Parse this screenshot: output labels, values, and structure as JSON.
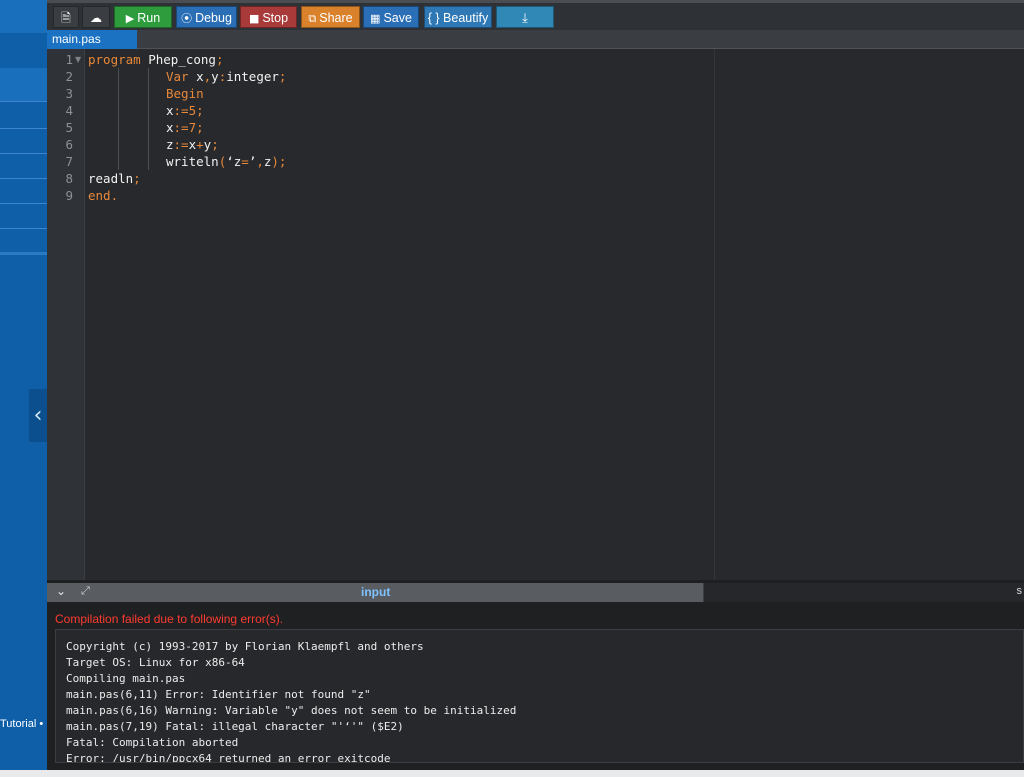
{
  "toolbar": {
    "buttons": [
      {
        "label": "",
        "icon": "new-file-icon",
        "color": "#3a3d42"
      },
      {
        "label": "",
        "icon": "upload-icon",
        "color": "#3a3d42"
      },
      {
        "label": "Run",
        "icon": "play-icon",
        "color": "#2e9c3d"
      },
      {
        "label": "Debug",
        "icon": "debug-icon",
        "color": "#2a6eb5"
      },
      {
        "label": "Stop",
        "icon": "stop-icon",
        "color": "#a83a3a"
      },
      {
        "label": "Share",
        "icon": "share-icon",
        "color": "#d9822b"
      },
      {
        "label": "Save",
        "icon": "save-icon",
        "color": "#2a6eb5"
      },
      {
        "label": "{ } Beautify",
        "icon": "",
        "color": "#2f78b6"
      },
      {
        "label": "",
        "icon": "download-icon",
        "color": "#2f88b6"
      }
    ]
  },
  "file_tab": "main.pas",
  "editor": {
    "lines": [
      {
        "num": "1",
        "text": "program Phep_cong;"
      },
      {
        "num": "2",
        "text": "Var x,y:integer;"
      },
      {
        "num": "3",
        "text": "Begin"
      },
      {
        "num": "4",
        "text": "x:=5;"
      },
      {
        "num": "5",
        "text": "x:=7;"
      },
      {
        "num": "6",
        "text": "z:=x+y;"
      },
      {
        "num": "7",
        "text": "writeln('z=',z);"
      },
      {
        "num": "8",
        "text": "readln;"
      },
      {
        "num": "9",
        "text": "end."
      }
    ]
  },
  "panel": {
    "input_label": "input",
    "right_label": "s"
  },
  "output": {
    "error_message": "Compilation failed due to following error(s).",
    "console_lines": [
      "Copyright (c) 1993-2017 by Florian Klaempfl and others",
      "Target OS: Linux for x86-64",
      "Compiling main.pas",
      "main.pas(6,11) Error: Identifier not found \"z\"",
      "main.pas(6,16) Warning: Variable \"y\" does not seem to be initialized",
      "main.pas(7,19) Fatal: illegal character \"'‘'\" ($E2)",
      "Fatal: Compilation aborted",
      "Error: /usr/bin/ppcx64 returned an error exitcode"
    ]
  },
  "sidebar": {
    "tutorial_label": "Tutorial •"
  },
  "colors": {
    "keyword": "#e8883a",
    "accent": "#1b72c2",
    "error": "#ff3b30"
  }
}
